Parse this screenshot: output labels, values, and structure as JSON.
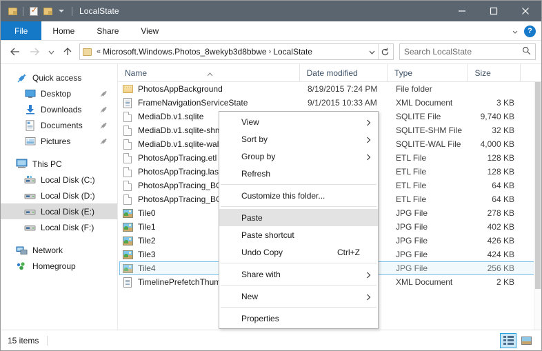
{
  "window": {
    "title": "LocalState",
    "quick_access_toolbar": [
      {
        "name": "folder-properties-icon",
        "label": "Properties"
      },
      {
        "name": "new-folder-icon",
        "label": "New folder"
      },
      {
        "name": "customize-qat-icon",
        "label": "Customize Quick Access Toolbar"
      }
    ],
    "controls": {
      "minimize": "Minimize",
      "maximize": "Maximize",
      "close": "Close"
    }
  },
  "ribbon": {
    "tabs": [
      {
        "label": "File",
        "active": true
      },
      {
        "label": "Home",
        "active": false
      },
      {
        "label": "Share",
        "active": false
      },
      {
        "label": "View",
        "active": false
      }
    ],
    "expand_label": "Expand the Ribbon",
    "help_label": "?"
  },
  "address_bar": {
    "back": "Back",
    "forward": "Forward",
    "recent": "Recent locations",
    "up": "Up",
    "overflow_chevron": "«",
    "crumbs": [
      "Microsoft.Windows.Photos_8wekyb3d8bbwe",
      "LocalState"
    ],
    "crumb_separator": "›",
    "dropdown": "Previous locations",
    "refresh": "Refresh"
  },
  "search": {
    "placeholder": "Search LocalState",
    "value": "",
    "icon": "search-icon"
  },
  "sidebar": {
    "items": [
      {
        "label": "Quick access",
        "icon": "pin-star-icon",
        "indent": false,
        "pinned": false,
        "selected": false
      },
      {
        "label": "Desktop",
        "icon": "desktop-icon",
        "indent": true,
        "pinned": true,
        "selected": false
      },
      {
        "label": "Downloads",
        "icon": "downloads-icon",
        "indent": true,
        "pinned": true,
        "selected": false
      },
      {
        "label": "Documents",
        "icon": "documents-icon",
        "indent": true,
        "pinned": true,
        "selected": false
      },
      {
        "label": "Pictures",
        "icon": "pictures-icon",
        "indent": true,
        "pinned": true,
        "selected": false
      },
      {
        "label": "This PC",
        "icon": "this-pc-icon",
        "indent": false,
        "pinned": false,
        "selected": false
      },
      {
        "label": "Local Disk (C:)",
        "icon": "system-drive-icon",
        "indent": true,
        "pinned": false,
        "selected": false
      },
      {
        "label": "Local Disk (D:)",
        "icon": "drive-icon",
        "indent": true,
        "pinned": false,
        "selected": false
      },
      {
        "label": "Local Disk (E:)",
        "icon": "drive-icon",
        "indent": true,
        "pinned": false,
        "selected": true
      },
      {
        "label": "Local Disk (F:)",
        "icon": "drive-icon",
        "indent": true,
        "pinned": false,
        "selected": false
      },
      {
        "label": "Network",
        "icon": "network-icon",
        "indent": false,
        "pinned": false,
        "selected": false
      },
      {
        "label": "Homegroup",
        "icon": "homegroup-icon",
        "indent": false,
        "pinned": false,
        "selected": false
      }
    ]
  },
  "file_list": {
    "columns": [
      {
        "key": "name",
        "label": "Name",
        "sorted": "asc"
      },
      {
        "key": "date",
        "label": "Date modified",
        "sorted": null
      },
      {
        "key": "type",
        "label": "Type",
        "sorted": null
      },
      {
        "key": "size",
        "label": "Size",
        "sorted": null
      }
    ],
    "rows": [
      {
        "name": "PhotosAppBackground",
        "icon": "folder-icon",
        "date": "8/19/2015 7:24 PM",
        "type": "File folder",
        "size": "",
        "selected": false
      },
      {
        "name": "FrameNavigationServiceState",
        "icon": "xml-file-icon",
        "date": "9/1/2015 10:33 AM",
        "type": "XML Document",
        "size": "3 KB",
        "selected": false
      },
      {
        "name": "MediaDb.v1.sqlite",
        "icon": "generic-file-icon",
        "date": "",
        "type": "SQLITE File",
        "size": "9,740 KB",
        "selected": false
      },
      {
        "name": "MediaDb.v1.sqlite-shm",
        "icon": "generic-file-icon",
        "date": "",
        "type": "SQLITE-SHM File",
        "size": "32 KB",
        "selected": false
      },
      {
        "name": "MediaDb.v1.sqlite-wal",
        "icon": "generic-file-icon",
        "date": "",
        "type": "SQLITE-WAL File",
        "size": "4,000 KB",
        "selected": false
      },
      {
        "name": "PhotosAppTracing.etl",
        "icon": "generic-file-icon",
        "date": "",
        "type": "ETL File",
        "size": "128 KB",
        "selected": false
      },
      {
        "name": "PhotosAppTracing.last.etl",
        "icon": "generic-file-icon",
        "date": "",
        "type": "ETL File",
        "size": "128 KB",
        "selected": false
      },
      {
        "name": "PhotosAppTracing_BG.etl",
        "icon": "generic-file-icon",
        "date": "",
        "type": "ETL File",
        "size": "64 KB",
        "selected": false
      },
      {
        "name": "PhotosAppTracing_BG.last.etl",
        "icon": "generic-file-icon",
        "date": "",
        "type": "ETL File",
        "size": "64 KB",
        "selected": false
      },
      {
        "name": "Tile0",
        "icon": "jpg-file-icon",
        "date": "",
        "type": "JPG File",
        "size": "278 KB",
        "selected": false
      },
      {
        "name": "Tile1",
        "icon": "jpg-file-icon",
        "date": "",
        "type": "JPG File",
        "size": "402 KB",
        "selected": false
      },
      {
        "name": "Tile2",
        "icon": "jpg-file-icon",
        "date": "",
        "type": "JPG File",
        "size": "426 KB",
        "selected": false
      },
      {
        "name": "Tile3",
        "icon": "jpg-file-icon",
        "date": "",
        "type": "JPG File",
        "size": "424 KB",
        "selected": false
      },
      {
        "name": "Tile4",
        "icon": "jpg-file-icon",
        "date": "",
        "type": "JPG File",
        "size": "256 KB",
        "selected": true
      },
      {
        "name": "TimelinePrefetchThumbnails",
        "icon": "xml-file-icon",
        "date": "",
        "type": "XML Document",
        "size": "2 KB",
        "selected": false
      }
    ]
  },
  "context_menu": [
    {
      "label": "View",
      "submenu": true,
      "accel": "",
      "highlighted": false,
      "separator_after": false
    },
    {
      "label": "Sort by",
      "submenu": true,
      "accel": "",
      "highlighted": false,
      "separator_after": false
    },
    {
      "label": "Group by",
      "submenu": true,
      "accel": "",
      "highlighted": false,
      "separator_after": false
    },
    {
      "label": "Refresh",
      "submenu": false,
      "accel": "",
      "highlighted": false,
      "separator_after": true
    },
    {
      "label": "Customize this folder...",
      "submenu": false,
      "accel": "",
      "highlighted": false,
      "separator_after": true
    },
    {
      "label": "Paste",
      "submenu": false,
      "accel": "",
      "highlighted": true,
      "separator_after": false
    },
    {
      "label": "Paste shortcut",
      "submenu": false,
      "accel": "",
      "highlighted": false,
      "separator_after": false
    },
    {
      "label": "Undo Copy",
      "submenu": false,
      "accel": "Ctrl+Z",
      "highlighted": false,
      "separator_after": true
    },
    {
      "label": "Share with",
      "submenu": true,
      "accel": "",
      "highlighted": false,
      "separator_after": true
    },
    {
      "label": "New",
      "submenu": true,
      "accel": "",
      "highlighted": false,
      "separator_after": true
    },
    {
      "label": "Properties",
      "submenu": false,
      "accel": "",
      "highlighted": false,
      "separator_after": false
    }
  ],
  "status_bar": {
    "item_count": "15 items",
    "views": [
      {
        "name": "details-view-button",
        "label": "Details view",
        "active": true
      },
      {
        "name": "large-icons-view-button",
        "label": "Large icons view",
        "active": false
      }
    ]
  },
  "colors": {
    "titlebar": "#5a6570",
    "file_tab": "#1579c8",
    "selection_border": "#7cc2ea",
    "nav_highlight": "#dcdcdc",
    "menu_highlight": "#e3e3e3",
    "column_header_text": "#3b5066"
  }
}
